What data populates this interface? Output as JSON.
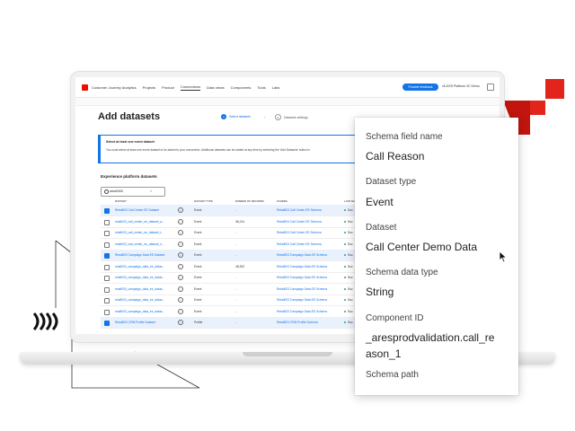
{
  "colors": {
    "accent": "#1473e6",
    "brand_red": "#eb1000",
    "success": "#2d9d78"
  },
  "topnav": {
    "app_title": "Customer Journey Analytics",
    "items": [
      "Projects",
      "Product",
      "Connections",
      "Data views",
      "Components",
      "Tools",
      "Labs"
    ],
    "active_item": "Connections",
    "feedback_label": "Provide feedback",
    "org_name": "c5-DSS Platform 3C Demo",
    "icons": {
      "logo": "adobe-logo-icon",
      "help": "help-icon"
    }
  },
  "page": {
    "title": "Add datasets",
    "steps": [
      {
        "number": "1",
        "label": "Select datasets",
        "active": true
      },
      {
        "number": "2",
        "label": "Datasets settings",
        "active": false
      }
    ]
  },
  "info_box": {
    "title": "Select at least one event dataset",
    "text": "You must select at least one event dataset to be added to your connection. Additional datasets can be added at any time by selecting the 'Add Datasets' button in"
  },
  "datasets_section": {
    "title": "Experience platform datasets",
    "search_value": "area0000",
    "columns": [
      "DATASET",
      "DATASET TYPE",
      "NUMBER OF RECORDS",
      "SCHEMA",
      "LAST BA"
    ],
    "rows": [
      {
        "name": "Retail003 Call Center EE Dataset",
        "type": "Event",
        "records": "-",
        "schema": "Retail003 Call Center EE Schema",
        "status": "Suc",
        "selected": true
      },
      {
        "name": "retail003_call_center_ee_dataset_a...",
        "type": "Event",
        "records": "36,214",
        "schema": "Retail003 Call Center EE Schema",
        "status": "Suc",
        "selected": false
      },
      {
        "name": "retail003_call_center_ee_dataset_t...",
        "type": "Event",
        "records": "-",
        "schema": "Retail003 Call Center EE Schema",
        "status": "Suc",
        "selected": false
      },
      {
        "name": "retail003_call_center_ee_dataset_n...",
        "type": "Event",
        "records": "-",
        "schema": "Retail003 Call Center EE Schema",
        "status": "Suc",
        "selected": false
      },
      {
        "name": "Retail003 Campaign Data EE Dataset",
        "type": "Event",
        "records": "-",
        "schema": "Retail003 Campaign Data EE Schema",
        "status": "Suc",
        "selected": true
      },
      {
        "name": "retail003_campaign_data_ee_datas...",
        "type": "Event",
        "records": "48,320",
        "schema": "Retail003 Campaign Data EE Schema",
        "status": "Suc",
        "selected": false
      },
      {
        "name": "retail003_campaign_data_ee_datas...",
        "type": "Event",
        "records": "-",
        "schema": "Retail003 Campaign Data EE Schema",
        "status": "Suc",
        "selected": false
      },
      {
        "name": "retail003_campaign_data_ee_datas...",
        "type": "Event",
        "records": "-",
        "schema": "Retail003 Campaign Data EE Schema",
        "status": "Suc",
        "selected": false
      },
      {
        "name": "retail003_campaign_data_ee_datas...",
        "type": "Event",
        "records": "-",
        "schema": "Retail003 Campaign Data EE Schema",
        "status": "Suc",
        "selected": false
      },
      {
        "name": "retail003_campaign_data_ee_datas...",
        "type": "Event",
        "records": "-",
        "schema": "Retail003 Campaign Data EE Schema",
        "status": "Suc",
        "selected": false
      },
      {
        "name": "Retail003 CRM Profile Dataset",
        "type": "Profile",
        "records": "-",
        "schema": "Retail003 CRM Profile Schema",
        "status": "Suc",
        "selected": true
      }
    ]
  },
  "popover": {
    "schema_field_name_label": "Schema field name",
    "schema_field_name_value": "Call Reason",
    "dataset_type_label": "Dataset type",
    "dataset_type_value": "Event",
    "dataset_label": "Dataset",
    "dataset_value": "Call Center Demo Data",
    "schema_data_type_label": "Schema data type",
    "schema_data_type_value": "String",
    "component_id_label": "Component ID",
    "component_id_value": "_aresprodvalidation.call_reason_1",
    "schema_path_label": "Schema path"
  }
}
